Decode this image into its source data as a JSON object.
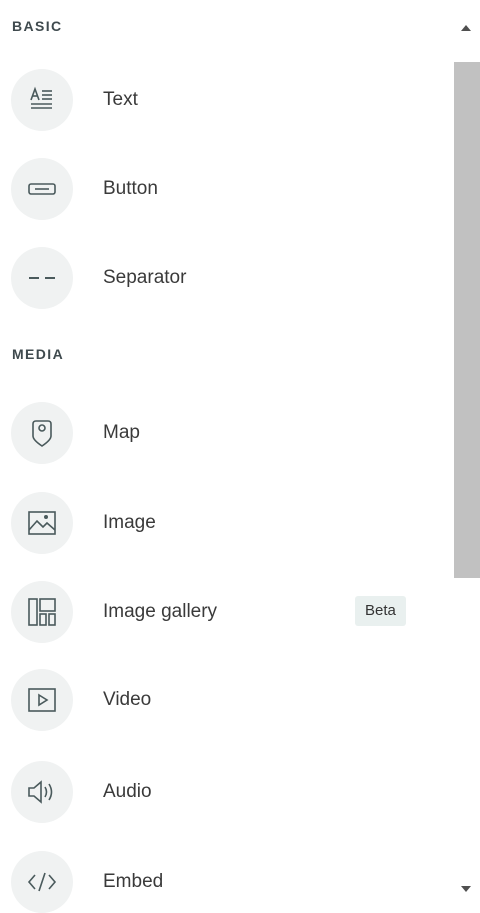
{
  "sections": [
    {
      "title": "BASIC",
      "items": [
        {
          "label": "Text",
          "icon": "text-icon"
        },
        {
          "label": "Button",
          "icon": "button-icon"
        },
        {
          "label": "Separator",
          "icon": "separator-icon"
        }
      ]
    },
    {
      "title": "MEDIA",
      "items": [
        {
          "label": "Map",
          "icon": "map-pin-icon"
        },
        {
          "label": "Image",
          "icon": "image-icon"
        },
        {
          "label": "Image gallery",
          "icon": "gallery-icon",
          "badge": "Beta"
        },
        {
          "label": "Video",
          "icon": "video-icon"
        },
        {
          "label": "Audio",
          "icon": "audio-icon"
        },
        {
          "label": "Embed",
          "icon": "embed-icon"
        }
      ]
    }
  ],
  "colors": {
    "icon_stroke": "#4a5a5c",
    "icon_bg": "#f0f2f2",
    "badge_bg": "#e9f0ef",
    "scroll_thumb": "#c1c1c1"
  }
}
